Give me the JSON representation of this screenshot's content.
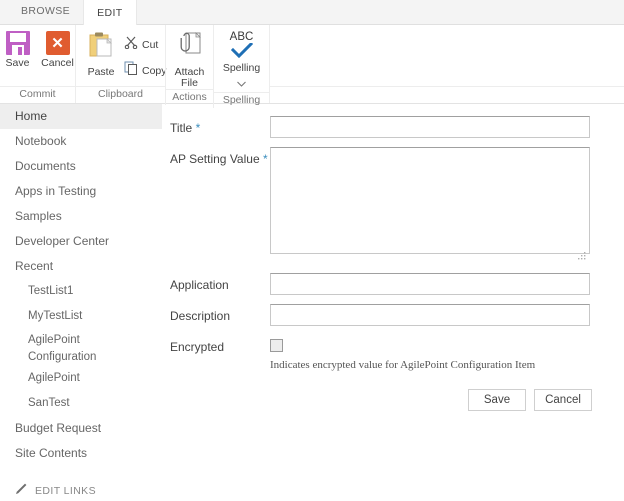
{
  "tabs": [
    {
      "label": "BROWSE",
      "active": false
    },
    {
      "label": "EDIT",
      "active": true
    }
  ],
  "ribbon": {
    "groups": [
      {
        "label": "Commit",
        "buttons": [
          {
            "label": "Save",
            "icon": "save-floppy-icon"
          },
          {
            "label": "Cancel",
            "icon": "cancel-x-icon"
          }
        ]
      },
      {
        "label": "Clipboard",
        "buttons": [
          {
            "label": "Paste",
            "icon": "paste-clipboard-icon"
          },
          {
            "label": "Cut",
            "icon": "scissors-icon"
          },
          {
            "label": "Copy",
            "icon": "copy-pages-icon"
          }
        ]
      },
      {
        "label": "Actions",
        "buttons": [
          {
            "label": "Attach\nFile",
            "label_line1": "Attach",
            "label_line2": "File",
            "icon": "paperclip-document-icon"
          }
        ]
      },
      {
        "label": "Spelling",
        "buttons": [
          {
            "label": "Spelling",
            "icon": "abc-checkmark-icon",
            "glyph_text": "ABC",
            "has_dropdown": true
          }
        ]
      }
    ]
  },
  "sidebar": {
    "items": [
      {
        "label": "Home",
        "selected": true,
        "level": 0
      },
      {
        "label": "Notebook",
        "selected": false,
        "level": 0
      },
      {
        "label": "Documents",
        "selected": false,
        "level": 0
      },
      {
        "label": "Apps in Testing",
        "selected": false,
        "level": 0
      },
      {
        "label": "Samples",
        "selected": false,
        "level": 0
      },
      {
        "label": "Developer Center",
        "selected": false,
        "level": 0
      },
      {
        "label": "Recent",
        "selected": false,
        "level": 0
      },
      {
        "label": "TestList1",
        "selected": false,
        "level": 1
      },
      {
        "label": "MyTestList",
        "selected": false,
        "level": 1
      },
      {
        "label": "AgilePoint Configuration",
        "selected": false,
        "level": 1,
        "wrap": true
      },
      {
        "label": "AgilePoint",
        "selected": false,
        "level": 1
      },
      {
        "label": "SanTest",
        "selected": false,
        "level": 1
      },
      {
        "label": "Budget Request",
        "selected": false,
        "level": 0
      },
      {
        "label": "Site Contents",
        "selected": false,
        "level": 0
      }
    ],
    "edit_links": {
      "label": "EDIT LINKS",
      "icon": "pencil-icon"
    }
  },
  "form": {
    "fields": {
      "title": {
        "label": "Title",
        "required": true,
        "required_mark": "*",
        "value": "",
        "placeholder": ""
      },
      "ap_setting_value": {
        "label": "AP Setting Value",
        "required": true,
        "required_mark": "*",
        "value": "",
        "placeholder": ""
      },
      "application": {
        "label": "Application",
        "required": false,
        "value": "",
        "placeholder": ""
      },
      "description": {
        "label": "Description",
        "required": false,
        "value": "",
        "placeholder": ""
      },
      "encrypted": {
        "label": "Encrypted",
        "required": false,
        "checked": false,
        "help": "Indicates encrypted value for AgilePoint Configuration Item"
      }
    },
    "buttons": {
      "save": "Save",
      "cancel": "Cancel"
    }
  },
  "colors": {
    "save_icon": "#bf5fc4",
    "cancel_icon": "#e05c30",
    "paste_icon": "#f0cf7a",
    "spelling_check": "#1f6fb5",
    "required_asterisk": "#3a8dbd",
    "selected_nav_bg": "#eeeeee",
    "tabstrip_bg": "#f4f4f4"
  }
}
